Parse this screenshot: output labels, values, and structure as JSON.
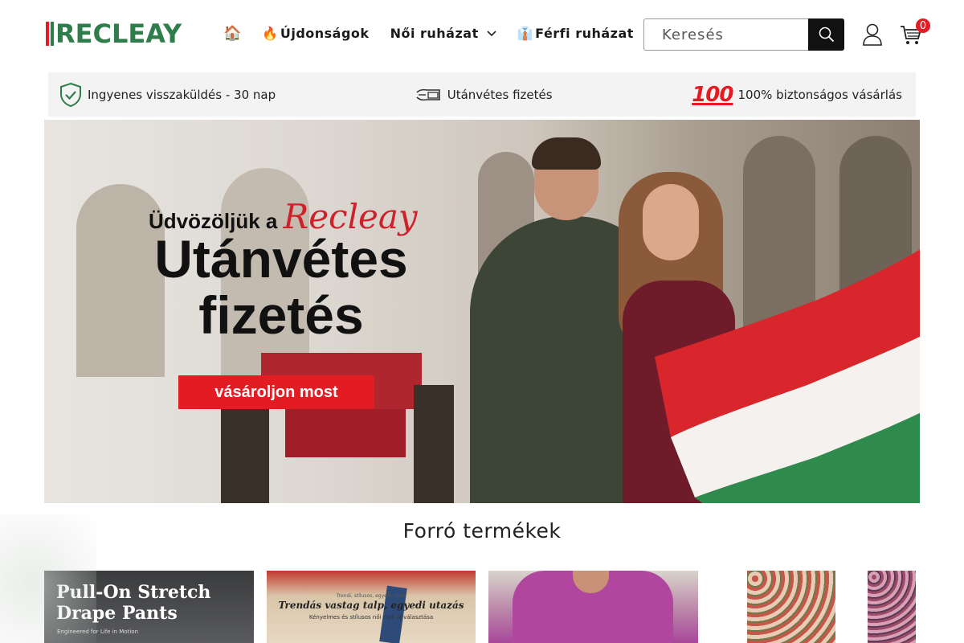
{
  "header": {
    "logo_text": "RECLEAY",
    "nav": [
      {
        "icon": "home-icon",
        "label": ""
      },
      {
        "emoji": "🔥",
        "label": "Újdonságok"
      },
      {
        "label": "Női ruházat",
        "has_dropdown": true
      },
      {
        "emoji": "👔",
        "label": "Férfi ruházat"
      }
    ],
    "search": {
      "placeholder": "Keresés"
    },
    "cart_count": "0"
  },
  "trust_bar": {
    "items": [
      {
        "icon": "shield-check-icon",
        "label": "Ingyenes visszaküldés - 30 nap"
      },
      {
        "icon": "cash-payment-icon",
        "label": "Utánvétes fizetés"
      },
      {
        "icon": "hundred-icon",
        "badge": "100",
        "label": "100% biztonságos vásárlás"
      }
    ]
  },
  "hero": {
    "welcome": "Üdvözöljük a ",
    "brand": "Recleay",
    "title_line1": "Utánvétes",
    "title_line2": "fizetés",
    "cta": "vásároljon most"
  },
  "section": {
    "title": "Forró termékek"
  },
  "products": [
    {
      "title_line1": "Pull-On Stretch",
      "title_line2": "Drape Pants",
      "subtitle": "Engineered for Life in Motion"
    },
    {
      "pre": "Trendi, stílusos, egyedi cipők",
      "title": "Trendás vastag talp, egyedi utazás",
      "subtitle": "Kényelmes és stílusos női cipő új választása"
    },
    {},
    {}
  ],
  "colors": {
    "accent": "#e31b23",
    "brand_green": "#2e7d4a",
    "trust_bg": "#f3f3f3"
  }
}
